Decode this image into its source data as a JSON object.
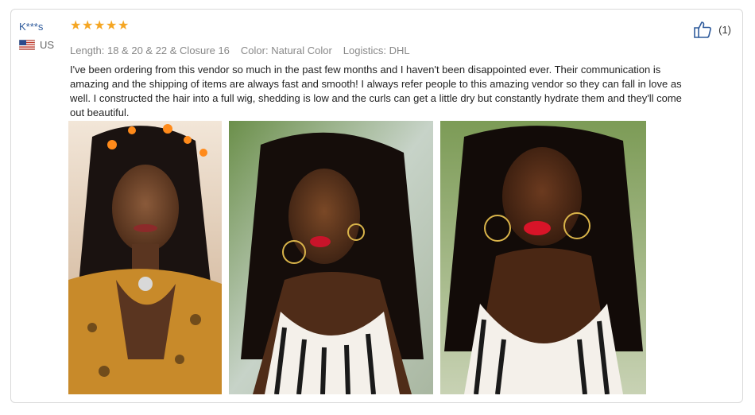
{
  "review": {
    "reviewer_name": "K***s",
    "country": "US",
    "rating": 5,
    "meta": {
      "length": "Length: 18 & 20 & 22 & Closure 16",
      "color": "Color: Natural Color",
      "logistics": "Logistics: DHL"
    },
    "text": "I've been ordering from this vendor so much in the past few months and I haven't been disappointed ever. Their communication is amazing and the shipping of items are always fast and smooth! I always refer people to this amazing vendor so they can fall in love as well. I constructed the hair into a full wig, shedding is low and the curls can get a little dry but constantly hydrate them and they'll come out beautiful.",
    "helpful_count": "(1)"
  },
  "colors": {
    "star": "#f5a623",
    "reviewer_name": "#2f5b9c",
    "meta_text": "#888888",
    "card_border": "#d9d9d9"
  },
  "icons": {
    "thumbs_up": "thumbs-up-icon",
    "flag": "us-flag-icon",
    "star": "star-icon"
  }
}
